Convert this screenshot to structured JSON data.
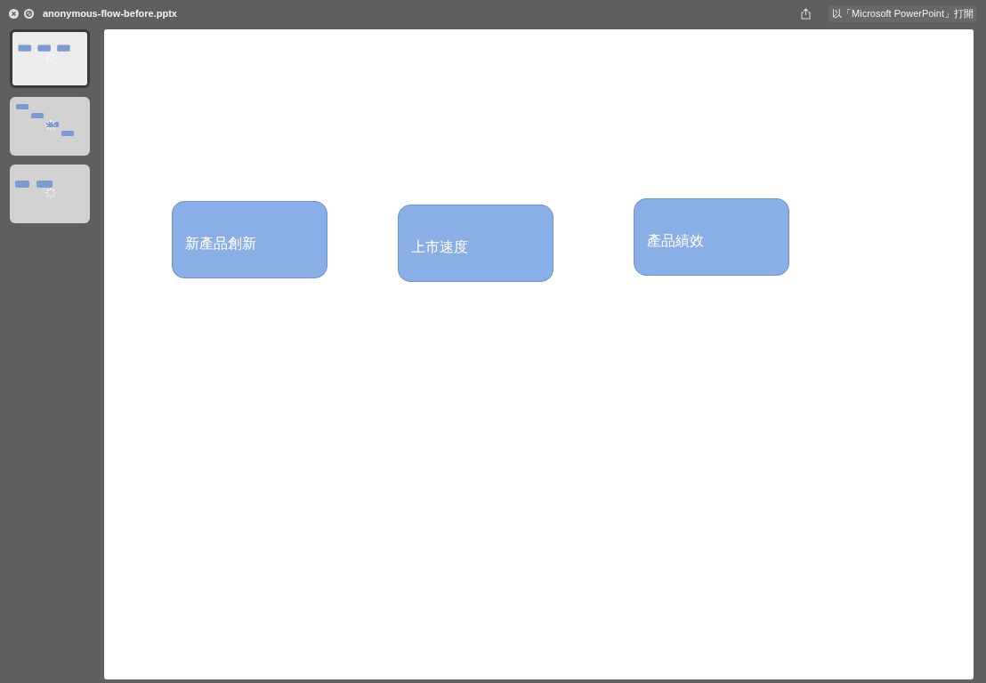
{
  "window": {
    "title": "anonymous-flow-before.pptx",
    "open_button": "以「Microsoft PowerPoint」打開"
  },
  "thumbnails": [
    {
      "selected": true
    },
    {
      "selected": false
    },
    {
      "selected": false
    }
  ],
  "slide": {
    "shapes": [
      {
        "text": "新產品創新"
      },
      {
        "text": "上市速度"
      },
      {
        "text": "產品績效"
      }
    ]
  }
}
